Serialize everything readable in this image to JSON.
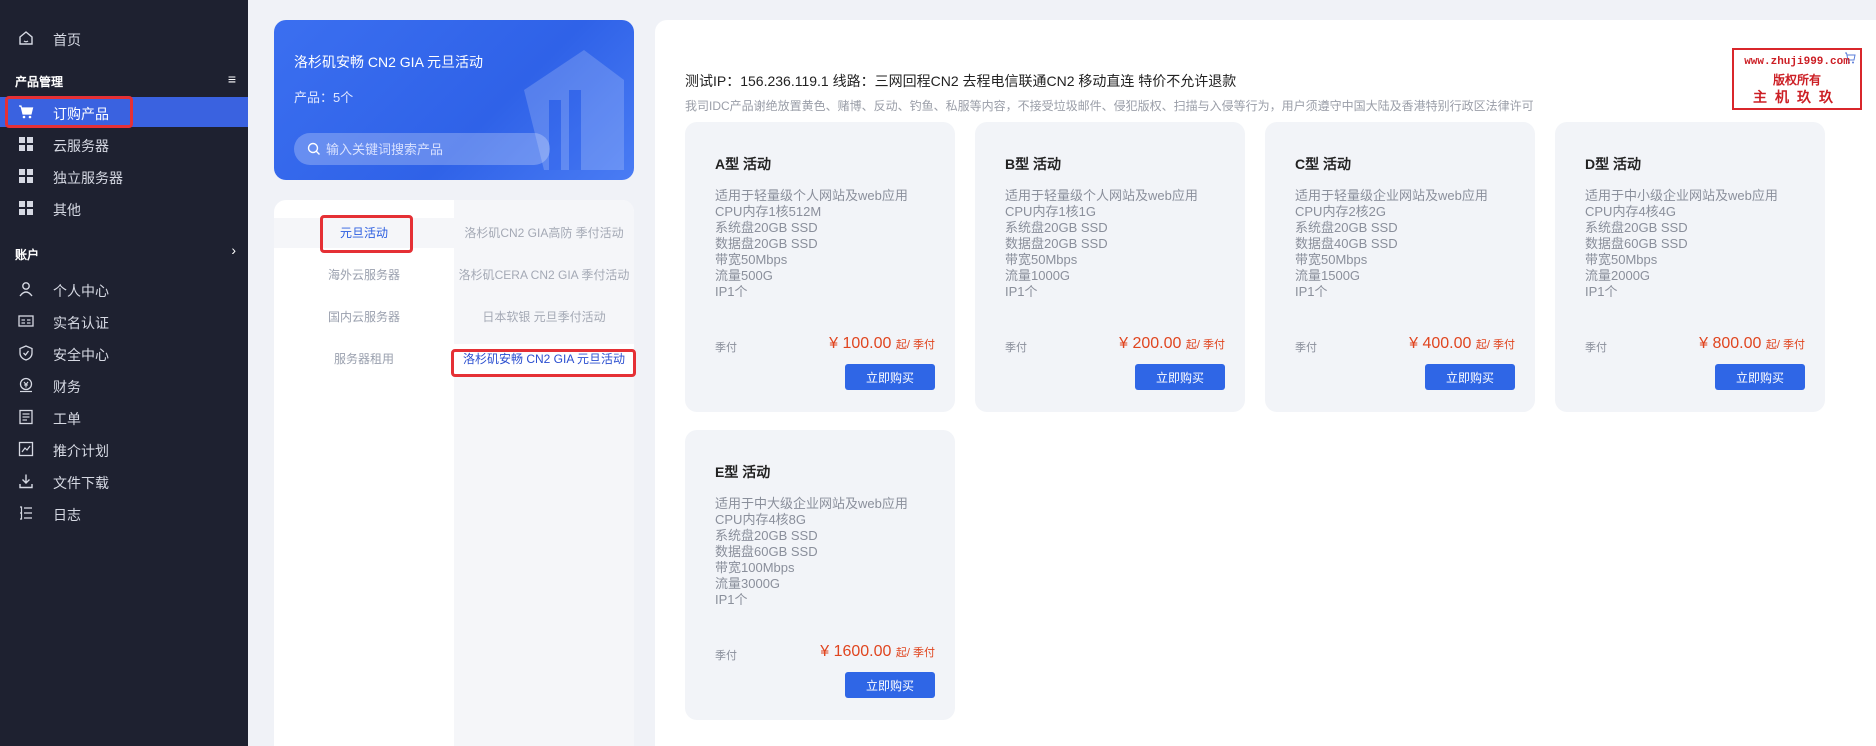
{
  "sidebar": {
    "home": "首页",
    "section_products": "产品管理",
    "items": [
      {
        "label": "订购产品"
      },
      {
        "label": "云服务器"
      },
      {
        "label": "独立服务器"
      },
      {
        "label": "其他"
      }
    ],
    "section_account": "账户",
    "account_items": [
      {
        "label": "个人中心"
      },
      {
        "label": "实名认证"
      },
      {
        "label": "安全中心"
      },
      {
        "label": "财务"
      },
      {
        "label": "工单"
      },
      {
        "label": "推介计划"
      },
      {
        "label": "文件下载"
      },
      {
        "label": "日志"
      }
    ]
  },
  "hero": {
    "title": "洛杉矶安畅 CN2 GIA 元旦活动",
    "count": "产品：5个",
    "search_placeholder": "输入关键词搜索产品"
  },
  "categories": {
    "left": [
      "元旦活动",
      "海外云服务器",
      "国内云服务器",
      "服务器租用"
    ],
    "right": [
      "洛杉矶CN2 GIA高防 季付活动",
      "洛杉矶CERA CN2 GIA 季付活动",
      "日本软银 元旦季付活动",
      "洛杉矶安畅 CN2 GIA 元旦活动"
    ]
  },
  "main": {
    "info_line": "测试IP：156.236.119.1 线路：三网回程CN2 去程电信联通CN2 移动直连 特价不允许退款",
    "notice_line": "我司IDC产品谢绝放置黄色、赌博、反动、钓鱼、私服等内容，不接受垃圾邮件、侵犯版权、扫描与入侵等行为，用户须遵守中国大陆及香港特别行政区法律许可"
  },
  "watermark": {
    "url": "www.zhuji999.com",
    "line2": "版权所有",
    "line3": "主机玖玖"
  },
  "products": [
    {
      "title": "A型 活动",
      "specs": [
        "适用于轻量级个人网站及web应用",
        "CPU内存1核512M",
        "系统盘20GB SSD",
        "数据盘20GB SSD",
        "带宽50Mbps",
        "流量500G",
        "IP1个"
      ],
      "cycle": "季付",
      "price": "¥ 100.00",
      "unit": "起/ 季付",
      "buy": "立即购买"
    },
    {
      "title": "B型 活动",
      "specs": [
        "适用于轻量级个人网站及web应用",
        "CPU内存1核1G",
        "系统盘20GB SSD",
        "数据盘20GB SSD",
        "带宽50Mbps",
        "流量1000G",
        "IP1个"
      ],
      "cycle": "季付",
      "price": "¥ 200.00",
      "unit": "起/ 季付",
      "buy": "立即购买"
    },
    {
      "title": "C型 活动",
      "specs": [
        "适用于轻量级企业网站及web应用",
        "CPU内存2核2G",
        "系统盘20GB SSD",
        "数据盘40GB SSD",
        "带宽50Mbps",
        "流量1500G",
        "IP1个"
      ],
      "cycle": "季付",
      "price": "¥ 400.00",
      "unit": "起/ 季付",
      "buy": "立即购买"
    },
    {
      "title": "D型 活动",
      "specs": [
        "适用于中小级企业网站及web应用",
        "CPU内存4核4G",
        "系统盘20GB SSD",
        "数据盘60GB SSD",
        "带宽50Mbps",
        "流量2000G",
        "IP1个"
      ],
      "cycle": "季付",
      "price": "¥ 800.00",
      "unit": "起/ 季付",
      "buy": "立即购买"
    },
    {
      "title": "E型 活动",
      "specs": [
        "适用于中大级企业网站及web应用",
        "CPU内存4核8G",
        "系统盘20GB SSD",
        "数据盘60GB SSD",
        "带宽100Mbps",
        "流量3000G",
        "IP1个"
      ],
      "cycle": "季付",
      "price": "¥ 1600.00",
      "unit": "起/ 季付",
      "buy": "立即购买"
    }
  ],
  "colors": {
    "sidebar_bg": "#1e2130",
    "active_blue": "#3a62e0",
    "price_orange": "#e0451f",
    "highlight_red": "#e53035"
  }
}
